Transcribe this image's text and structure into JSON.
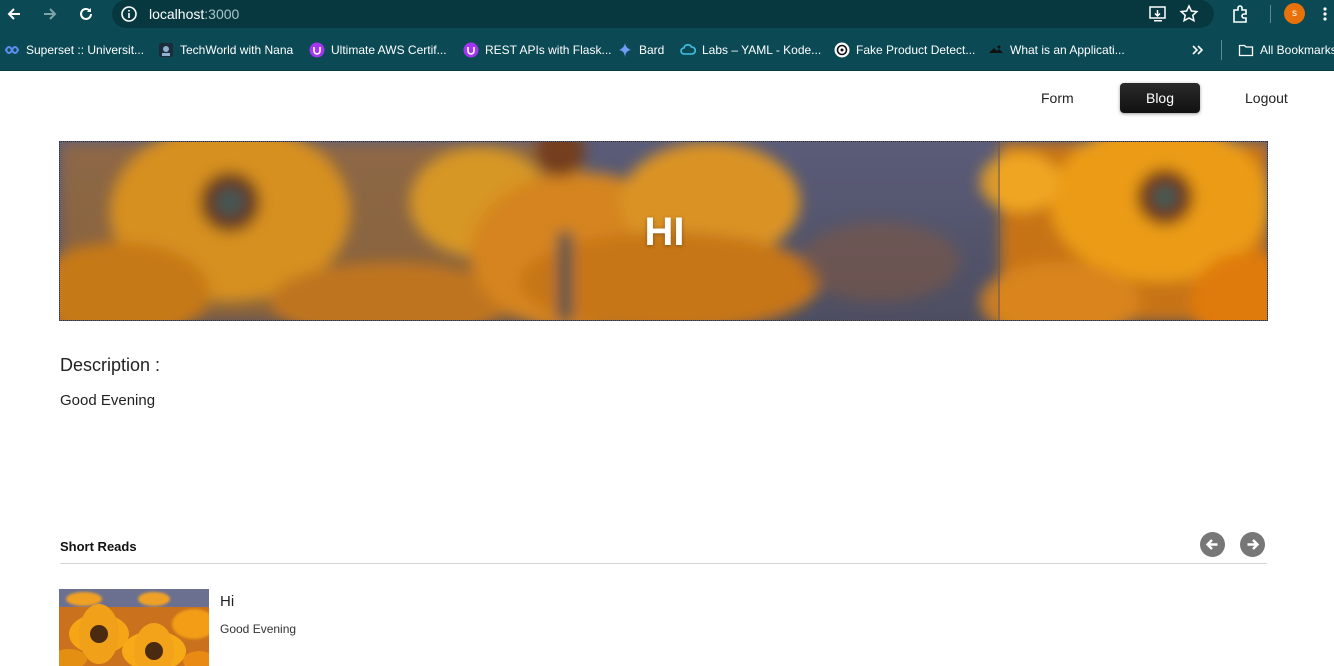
{
  "browser": {
    "url_host": "localhost",
    "url_port": ":3000",
    "profile_initial": "s",
    "bookmarks": [
      {
        "label": "Superset :: Universit...",
        "icon": "superset-icon"
      },
      {
        "label": "TechWorld with Nana",
        "icon": "techworld-icon"
      },
      {
        "label": "Ultimate AWS Certif...",
        "icon": "udemy-icon"
      },
      {
        "label": "REST APIs with Flask...",
        "icon": "udemy-icon"
      },
      {
        "label": "Bard",
        "icon": "bard-sparkle-icon"
      },
      {
        "label": "Labs – YAML - Kode...",
        "icon": "kodekloud-icon"
      },
      {
        "label": "Fake Product Detect...",
        "icon": "chatgpt-icon"
      },
      {
        "label": "What is an Applicati...",
        "icon": "page-icon"
      }
    ],
    "all_bookmarks_label": "All Bookmarks",
    "colors": {
      "chrome": "#0b4a55",
      "omnibox": "#073840",
      "profile": "#e8710a"
    }
  },
  "nav": {
    "form": "Form",
    "blog": "Blog",
    "logout": "Logout"
  },
  "hero": {
    "title": "HI"
  },
  "description": {
    "label": "Description :",
    "text": "Good Evening"
  },
  "short_reads": {
    "title": "Short Reads",
    "prev_icon": "arrow-left-circle-icon",
    "next_icon": "arrow-right-circle-icon",
    "items": [
      {
        "title": "Hi",
        "text": "Good Evening"
      }
    ]
  }
}
